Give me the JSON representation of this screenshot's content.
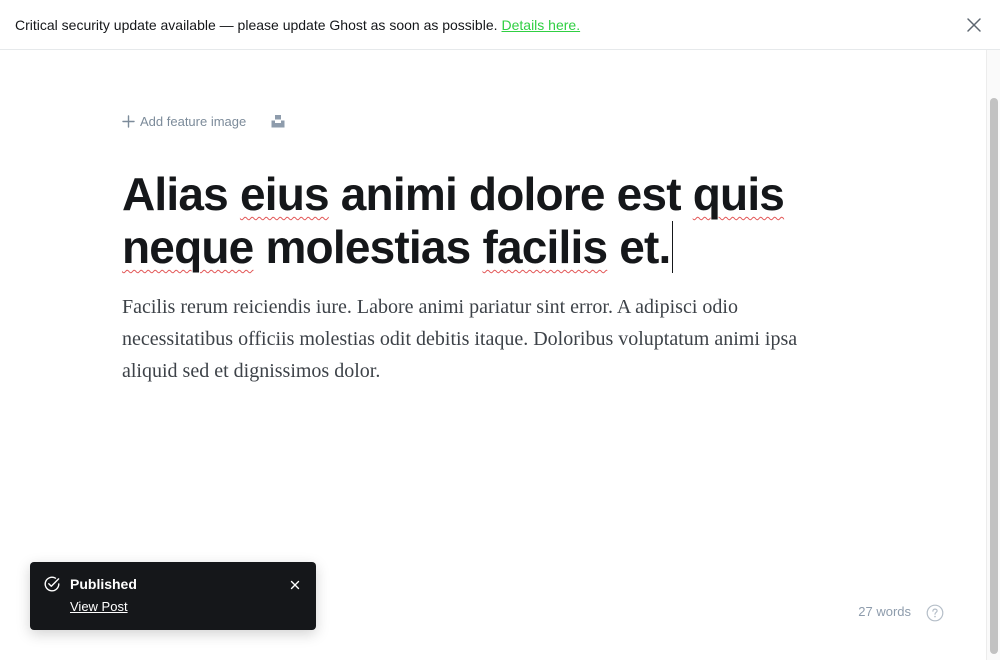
{
  "banner": {
    "message": "Critical security update available — please update Ghost as soon as possible.",
    "link_label": "Details here."
  },
  "editor": {
    "add_feature_image_label": "Add feature image",
    "title_segments": [
      {
        "text": "Alias ",
        "spell": false
      },
      {
        "text": "eius",
        "spell": true
      },
      {
        "text": " animi dolore est ",
        "spell": false
      },
      {
        "text": "quis",
        "spell": true
      },
      {
        "text": " ",
        "spell": false
      },
      {
        "text": "neque",
        "spell": true
      },
      {
        "text": " molestias ",
        "spell": false
      },
      {
        "text": "facilis",
        "spell": true
      },
      {
        "text": " et.",
        "spell": false
      }
    ],
    "body": "Facilis rerum reiciendis iure. Labore animi pariatur sint error. A adipisci odio necessitatibus officiis molestias odit debitis itaque. Doloribus voluptatum animi ipsa aliquid sed et dignissimos dolor."
  },
  "footer": {
    "word_count": "27 words"
  },
  "toast": {
    "title": "Published",
    "link_label": "View Post"
  },
  "colors": {
    "link_green": "#30cf43",
    "spell_underline": "#e25656",
    "toast_bg": "#15171a"
  },
  "icons": {
    "banner_close": "close-icon",
    "add_feature": "plus-icon",
    "unsplash": "unsplash-icon",
    "help": "help-icon",
    "toast_status": "check-circle-icon",
    "toast_close": "close-icon"
  }
}
